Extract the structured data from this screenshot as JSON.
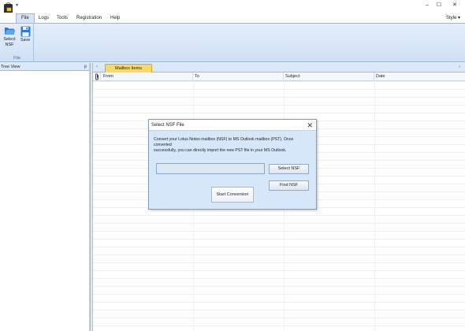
{
  "titlebar": {
    "minimize": "–",
    "maximize": "☐",
    "close": "✕",
    "quick_access_caret": "▾"
  },
  "menu": {
    "tabs": [
      "File",
      "Logs",
      "Tools",
      "Registration",
      "Help"
    ],
    "style": "Style ▾"
  },
  "ribbon": {
    "buttons": [
      {
        "icon": "folder-icon",
        "label_line1": "Select",
        "label_line2": "NSF"
      },
      {
        "icon": "floppy-disk-icon",
        "label_line1": "Save"
      }
    ],
    "group_caption": "File"
  },
  "tree_view": {
    "title": "Tree View",
    "pin": "ᵽ"
  },
  "mailbox": {
    "tab_label": "Mailbox Items",
    "nav_left": "‹",
    "nav_right": "›",
    "attachment_icon": "paperclip-icon",
    "columns": [
      "From",
      "To",
      "Subject",
      "Date"
    ]
  },
  "dialog": {
    "title": "Select NSF File",
    "close": "✕",
    "description_line1": "Convert your Lotus Notes mailbox (NSF) to MS Outlook mailbox (PST). Once converted",
    "description_line2": "successfully, you can directly import the new PST file in your MS Outlook.",
    "path_value": "",
    "select_button": "Select NSF",
    "find_button": "Find NSF",
    "start_button": "Start Conversion"
  },
  "colors": {
    "ribbon": "#d5e5f7",
    "dialog_background": "#d6e7fa",
    "active_tab": "#f7d96b"
  }
}
